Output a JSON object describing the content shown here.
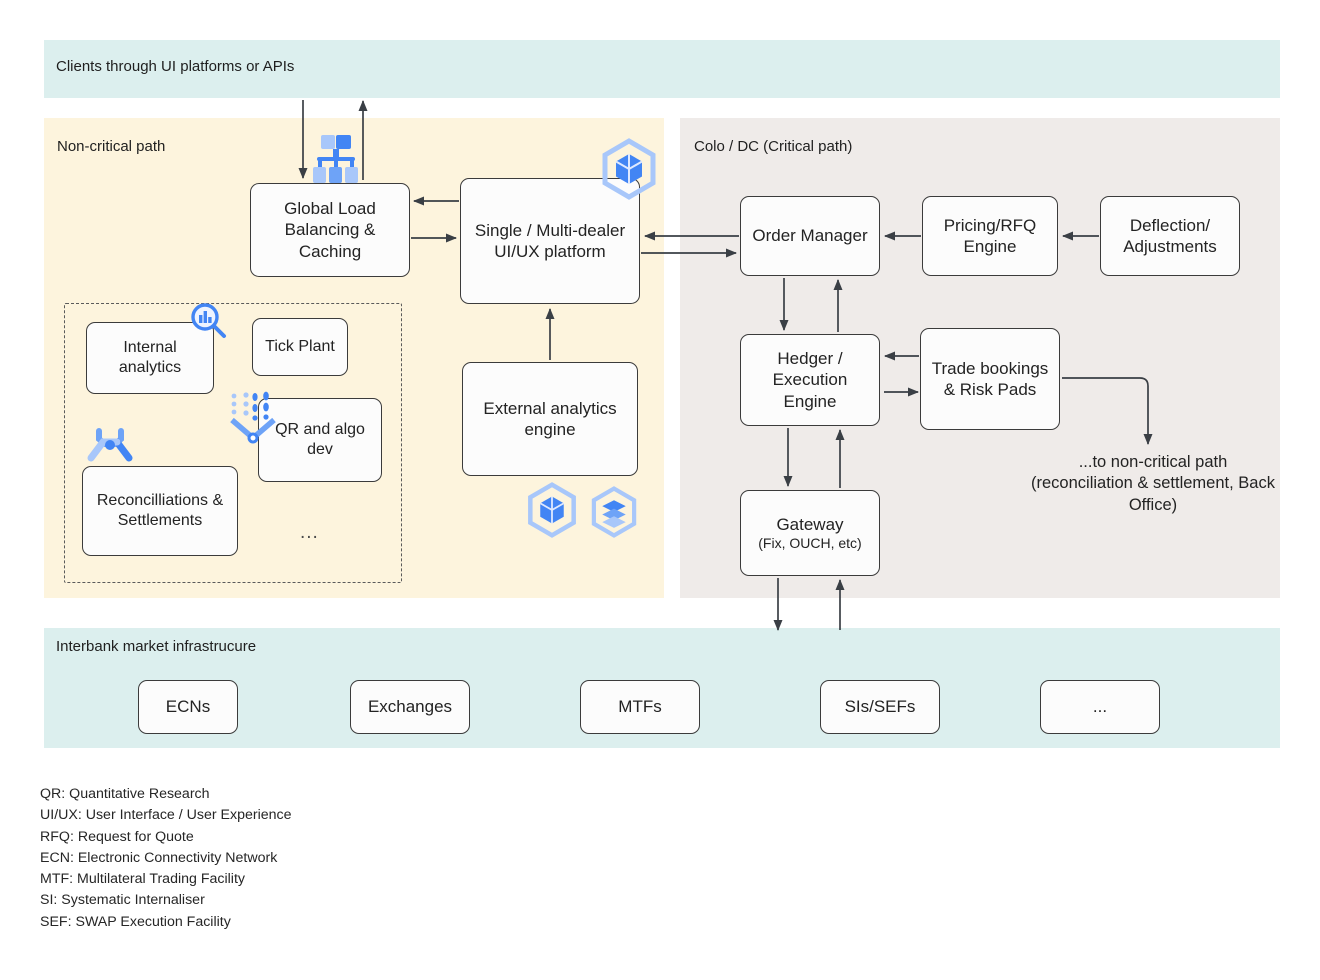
{
  "panels": {
    "clients": {
      "title": "Clients through UI platforms or APIs",
      "color": "#dcefee"
    },
    "non_critical": {
      "title": "Non-critical path",
      "color": "#fdf4dd"
    },
    "colo": {
      "title": "Colo / DC (Critical path)",
      "color": "#efebe9"
    },
    "interbank": {
      "title": "Interbank market infrastrucure",
      "color": "#dcefee"
    }
  },
  "nodes": {
    "global_load_balancing": "Global Load Balancing & Caching",
    "ui_platform": "Single / Multi-dealer UI/UX platform",
    "external_analytics": "External analytics engine",
    "internal_analytics": "Internal analytics",
    "tick_plant": "Tick Plant",
    "qr_algo_dev": "QR and algo dev",
    "reconciliations": "Reconcilliations & Settlements",
    "group_ellipsis": "...",
    "order_manager": "Order Manager",
    "pricing_rfq": "Pricing/RFQ Engine",
    "deflection": "Deflection/ Adjustments",
    "hedger": "Hedger / Execution Engine",
    "trade_bookings": "Trade bookings & Risk Pads",
    "gateway_title": "Gateway",
    "gateway_sub": "(Fix, OUCH, etc)",
    "to_non_critical": "...to non-critical path (reconciliation & settlement, Back Office)"
  },
  "venues": [
    {
      "label": "ECNs"
    },
    {
      "label": "Exchanges"
    },
    {
      "label": "MTFs"
    },
    {
      "label": "SIs/SEFs"
    },
    {
      "label": "..."
    }
  ],
  "legend": [
    "QR: Quantitative Research",
    "UI/UX: User Interface / User Experience",
    "RFQ: Request for Quote",
    "ECN: Electronic Connectivity Network",
    "MTF: Multilateral Trading Facility",
    "SI: Systematic Internaliser",
    "SEF: SWAP Execution Facility"
  ],
  "icons": {
    "load_balancer": "load-balancer-icon",
    "cube_hex": "cube-hexagon-icon",
    "stack_hex": "stack-hexagon-icon",
    "magnifier_chart": "analytics-magnifier-icon",
    "wrench": "wrench-tools-icon",
    "data_funnel": "data-funnel-icon"
  },
  "colors": {
    "accent_blue": "#4285f4",
    "light_blue": "#a8c7fa",
    "line": "#3a3f45",
    "node_border": "#3b3b3b"
  }
}
